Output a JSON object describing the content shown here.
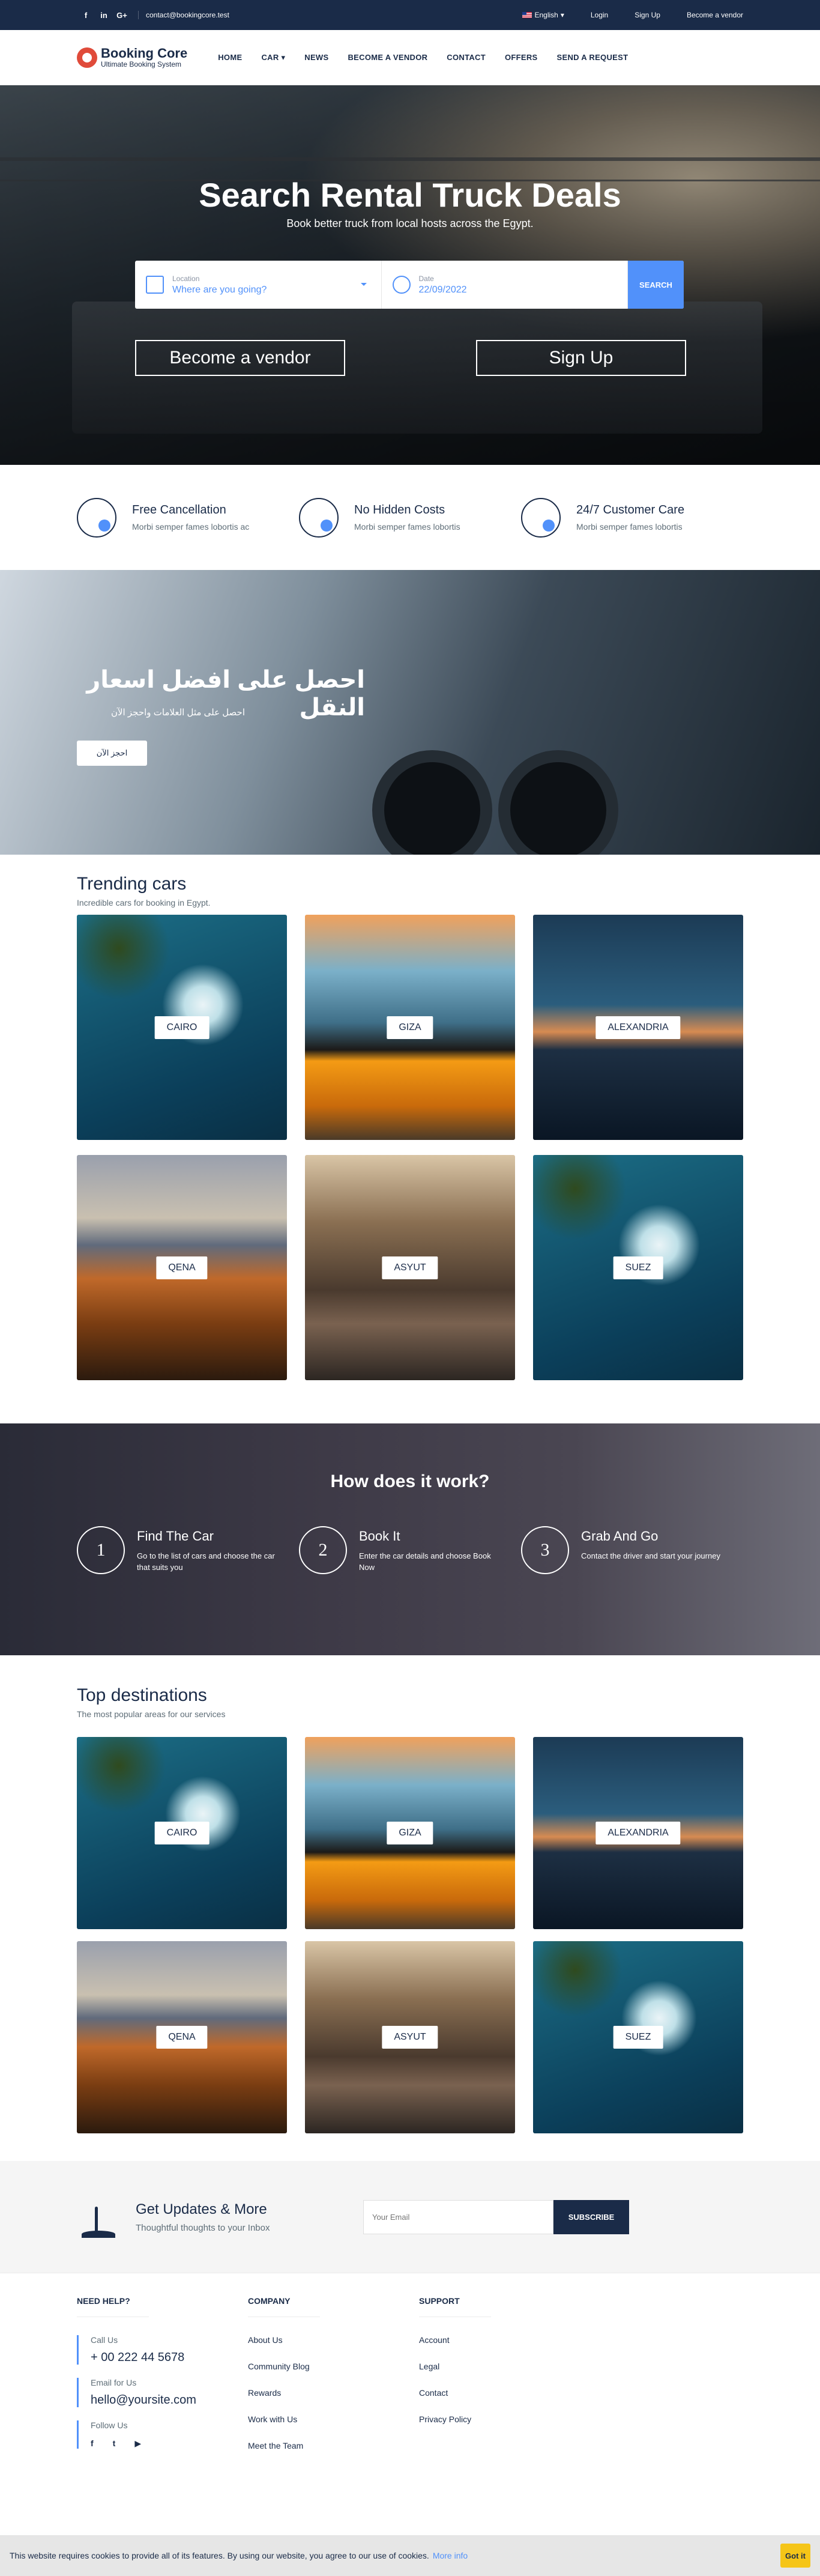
{
  "topbar": {
    "social": [
      "f",
      "in",
      "G+"
    ],
    "email": "contact@bookingcore.test",
    "language": "English",
    "login": "Login",
    "signup": "Sign Up",
    "become_vendor": "Become a vendor"
  },
  "header": {
    "logo_name": "Booking Core",
    "logo_tagline": "Ultimate Booking System",
    "nav": [
      "HOME",
      "CAR",
      "NEWS",
      "BECOME A VENDOR",
      "CONTACT",
      "OFFERS",
      "SEND A REQUEST"
    ]
  },
  "hero": {
    "title": "Search Rental Truck Deals",
    "subtitle": "Book better truck from local hosts across the Egypt.",
    "location_label": "Location",
    "location_placeholder": "Where are you going?",
    "date_label": "Date",
    "date_value": "22/09/2022",
    "search_button": "SEARCH",
    "vendor_button": "Become a vendor",
    "signup_button": "Sign Up"
  },
  "features": [
    {
      "icon": "globe-pin-icon",
      "title": "Free Cancellation",
      "text": "Morbi semper fames lobortis ac"
    },
    {
      "icon": "umbrella-icon",
      "title": "No Hidden Costs",
      "text": "Morbi semper fames lobortis"
    },
    {
      "icon": "piggy-bank-icon",
      "title": "24/7 Customer Care",
      "text": "Morbi semper fames lobortis"
    }
  ],
  "promo": {
    "title": "احصل على افضل اسعار النقل",
    "subtitle": "احصل على مثل العلامات واحجز الآن",
    "button": "احجز الآن"
  },
  "trending": {
    "title": "Trending cars",
    "subtitle": "Incredible cars for booking in Egypt.",
    "cities": [
      "CAIRO",
      "GIZA",
      "ALEXANDRIA",
      "QENA",
      "ASYUT",
      "SUEZ"
    ]
  },
  "how": {
    "title": "How does it work?",
    "steps": [
      {
        "num": "1",
        "title": "Find The Car",
        "text": "Go to the list of cars and choose the car that suits you"
      },
      {
        "num": "2",
        "title": "Book It",
        "text": "Enter the car details and choose Book Now"
      },
      {
        "num": "3",
        "title": "Grab And Go",
        "text": "Contact the driver and start your journey"
      }
    ]
  },
  "destinations": {
    "title": "Top destinations",
    "subtitle": "The most popular areas for our services",
    "cities": [
      "CAIRO",
      "GIZA",
      "ALEXANDRIA",
      "QENA",
      "ASYUT",
      "SUEZ"
    ]
  },
  "newsletter": {
    "title": "Get Updates & More",
    "subtitle": "Thoughtful thoughts to your Inbox",
    "placeholder": "Your Email",
    "button": "SUBSCRIBE"
  },
  "footer": {
    "help_title": "NEED HELP?",
    "call_label": "Call Us",
    "phone": "+ 00 222 44 5678",
    "email_label": "Email for Us",
    "email": "hello@yoursite.com",
    "follow_label": "Follow Us",
    "company_title": "COMPANY",
    "company_links": [
      "About Us",
      "Community Blog",
      "Rewards",
      "Work with Us",
      "Meet the Team"
    ],
    "support_title": "SUPPORT",
    "support_links": [
      "Account",
      "Legal",
      "Contact",
      "Privacy Policy"
    ]
  },
  "cookie": {
    "text": "This website requires cookies to provide all of its features. By using our website, you agree to our use of cookies.",
    "more": "More info",
    "button": "Got it"
  },
  "colors": {
    "primary": "#5191fa",
    "dark": "#1a2b48",
    "accent": "#f5c518"
  }
}
